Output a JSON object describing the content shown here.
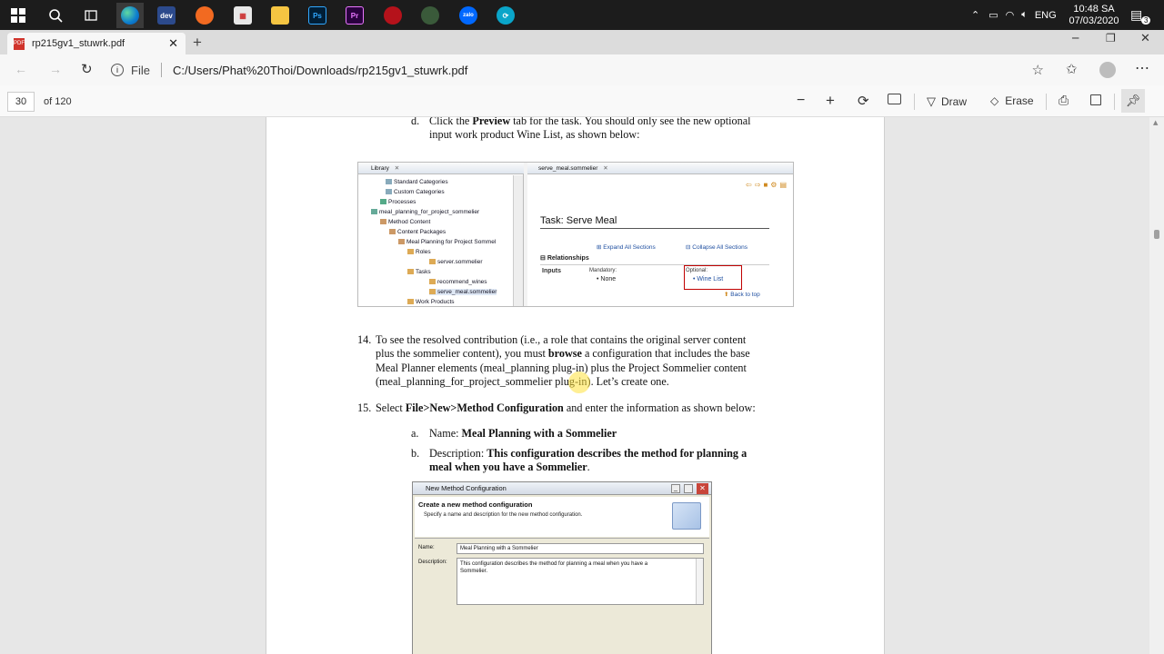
{
  "taskbar": {
    "time": "10:48 SA",
    "date": "07/03/2020",
    "language": "ENG",
    "notification_count": "3",
    "apps": [
      "dev",
      "zalo"
    ]
  },
  "browser": {
    "tab_title": "rp215gv1_stuwrk.pdf",
    "address_scheme": "File",
    "address_url": "C:/Users/Phat%20Thoi/Downloads/rp215gv1_stuwrk.pdf"
  },
  "pdf_toolbar": {
    "page_number": "30",
    "page_total": "of 120",
    "draw_label": "Draw",
    "erase_label": "Erase"
  },
  "document": {
    "step_d": {
      "marker": "d.",
      "pre": "Click the ",
      "bold": "Preview",
      "post": " tab for the task.  You should only see the new optional",
      "line2": "input work product Wine List, as shown below:"
    },
    "library_shot": {
      "left_tab": "Library",
      "right_tab": "serve_meal.sommelier",
      "tree": [
        "Standard Categories",
        "Custom Categories",
        "Processes",
        "meal_planning_for_project_sommelier",
        "Method Content",
        "Content Packages",
        "Meal Planning for Project Sommel",
        "Roles",
        "server.sommelier",
        "Tasks",
        "recommend_wines",
        "serve_meal.sommelier",
        "Work Products"
      ],
      "task_title": "Task: Serve Meal",
      "expand_all": "Expand All Sections",
      "collapse_all": "Collapse All Sections",
      "relationships": "Relationships",
      "inputs": "Inputs",
      "mandatory": "Mandatory:",
      "none": "None",
      "optional": "Optional:",
      "wine_list": "Wine List",
      "back_to_top": "Back to top"
    },
    "step14": {
      "marker": "14.",
      "l1": "To see the resolved contribution (i.e., a role that contains the original server content",
      "l2_pre": "plus the sommelier content), you must ",
      "l2_bold": "browse",
      "l2_post": " a configuration that includes the base",
      "l3": "Meal Planner elements (meal_planning plug-in) plus the Project Sommelier content",
      "l4": "(meal_planning_for_project_sommelier plug-in).  Let’s create one."
    },
    "step15": {
      "marker": "15.",
      "pre": "Select ",
      "bold": "File>New>Method Configuration",
      "post": " and enter the information as shown below:"
    },
    "sub_a": {
      "marker": "a.",
      "pre": "Name: ",
      "bold": "Meal Planning with a Sommelier"
    },
    "sub_b": {
      "marker": "b.",
      "pre": "Description: ",
      "bold1": "This configuration describes the method for planning a",
      "bold2": "meal when you have a Sommelier",
      "post": "."
    },
    "dialog": {
      "title": "New Method Configuration",
      "heading": "Create a new method configuration",
      "subheading": "Specify a name and description for the new method configuration.",
      "name_label": "Name:",
      "name_value": "Meal Planning with a Sommelier",
      "desc_label": "Description:",
      "desc_value1": "This configuration describes the method for planning a meal when you have a",
      "desc_value2": "Sommelier."
    }
  },
  "colors": {
    "accent": "#0078d4",
    "highlight_red": "#c00000",
    "link_blue": "#1f4fa0"
  }
}
